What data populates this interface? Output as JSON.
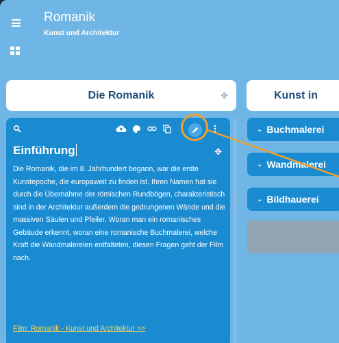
{
  "app": {
    "title": "Romanik",
    "subtitle": "Kunst und Architektur"
  },
  "columns": [
    {
      "title": "Die Romanik"
    },
    {
      "title": "Kunst in"
    }
  ],
  "card": {
    "title": "Einführung",
    "body": "Die Romanik, die im 8. Jahrhundert begann, war die erste Kunstepoche, die europaweit zu finden ist. Ihren Namen hat sie durch die Übernahme der römischen Rundbögen, charakteristisch sind in der Architektur außerdem die gedrungenen Wände und die massiven Säulen und Pfeiler. Woran man ein romanisches Gebäude erkennt, woran eine romanische Buchmalerei, welche Kraft die Wandmalereien entfalteten, diesen Fragen geht der Film nach.",
    "link": "Film: Romanik - Kunst und Architektur >>",
    "toolbar_icons": [
      "search-icon",
      "cloud-upload-icon",
      "palette-icon",
      "link-icon",
      "copy-icon",
      "edit-icon",
      "more-vertical-icon"
    ]
  },
  "sections": [
    {
      "label": "Buchmalerei"
    },
    {
      "label": "Wandmalerei"
    },
    {
      "label": "Bildhauerei"
    }
  ],
  "colors": {
    "board": "#6fb6e6",
    "card": "#1b8bd1",
    "highlight": "#f2a02a",
    "link": "#ffd84d"
  }
}
